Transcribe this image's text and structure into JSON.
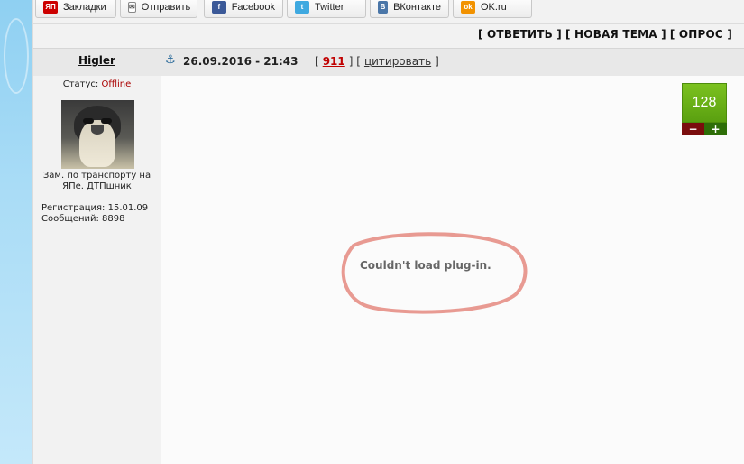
{
  "share_bar": {
    "buttons": [
      {
        "label": "Закладки",
        "icon": "ya-bookmarks-icon",
        "icon_text": "ЯП"
      },
      {
        "label": "Отправить",
        "icon": "mail-icon"
      },
      {
        "label": "Facebook",
        "icon": "facebook-icon",
        "icon_text": "f"
      },
      {
        "label": "Twitter",
        "icon": "twitter-icon",
        "icon_text": "t"
      },
      {
        "label": "ВКонтакте",
        "icon": "vk-icon",
        "icon_text": "В"
      },
      {
        "label": "OK.ru",
        "icon": "ok-icon",
        "icon_text": "ok"
      }
    ]
  },
  "actions": {
    "reply": "[ ОТВЕТИТЬ ]",
    "new_topic": "[ НОВАЯ ТЕМА ]",
    "poll": "[ ОПРОС ]"
  },
  "post": {
    "username": "Higler",
    "date": "26.09.2016 - 21:43",
    "bracket_open": "[",
    "post_number": "911",
    "bracket_mid": "] [",
    "quote_label": "цитировать",
    "bracket_close": "]",
    "status_label": "Статус:",
    "status_value": "Offline",
    "rank": "Зам. по транспорту на ЯПе. ДТПшник",
    "registration": "Регистрация: 15.01.09",
    "messages": "Сообщений: 8898",
    "rating": "128",
    "rating_minus": "−",
    "rating_plus": "+",
    "plugin_message": "Couldn't load plug-in."
  },
  "colors": {
    "offline": "#aa0000",
    "post_number": "#c00000",
    "rating_green": "#6cb31a",
    "annotation_circle": "#e89a92"
  }
}
